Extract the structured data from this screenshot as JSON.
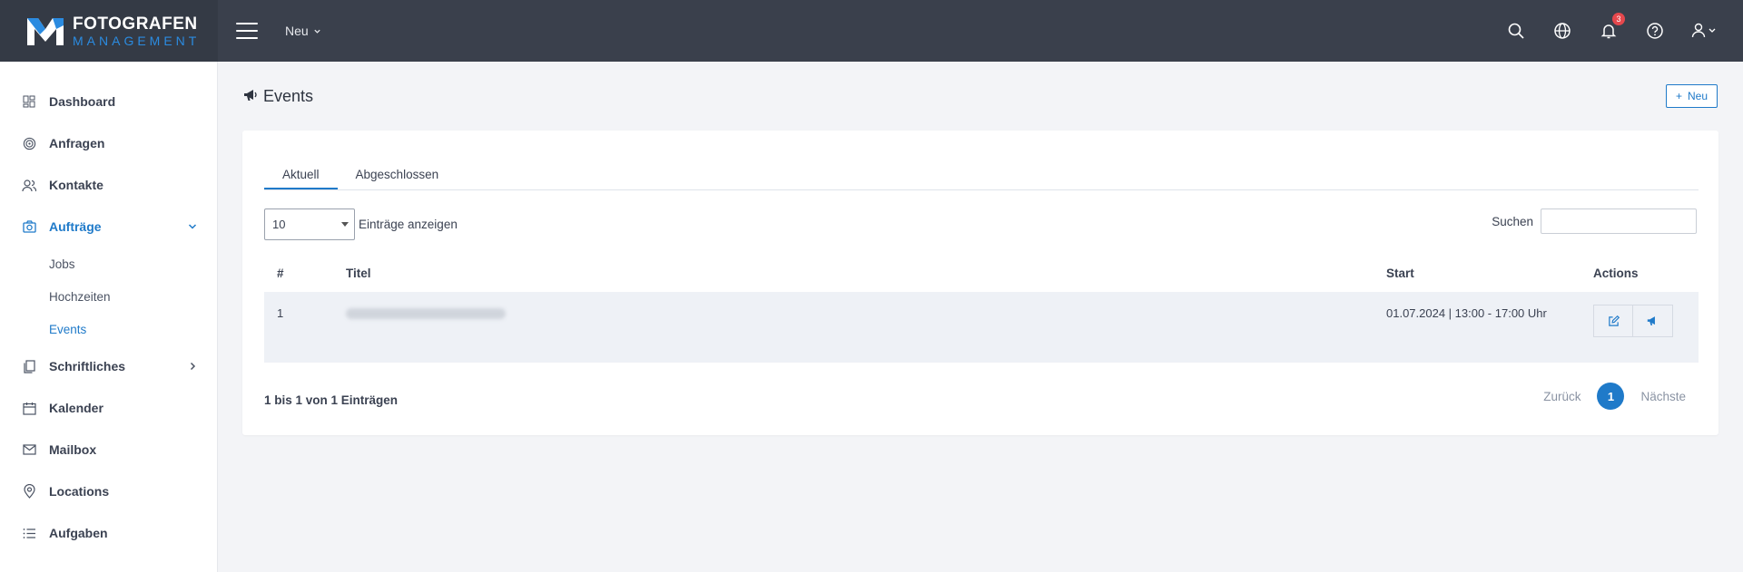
{
  "brand": {
    "line1": "FOTOGRAFEN",
    "line2": "MANAGEMENT",
    "accent": "#1f7ac9"
  },
  "topbar": {
    "new_label": "Neu",
    "notification_count": "3"
  },
  "sidebar": {
    "items": [
      {
        "label": "Dashboard",
        "icon": "dashboard-icon"
      },
      {
        "label": "Anfragen",
        "icon": "target-icon"
      },
      {
        "label": "Kontakte",
        "icon": "users-icon"
      },
      {
        "label": "Aufträge",
        "icon": "camera-icon"
      },
      {
        "label": "Schriftliches",
        "icon": "document-icon"
      },
      {
        "label": "Kalender",
        "icon": "calendar-icon"
      },
      {
        "label": "Mailbox",
        "icon": "mail-icon"
      },
      {
        "label": "Locations",
        "icon": "location-icon"
      },
      {
        "label": "Aufgaben",
        "icon": "list-icon"
      }
    ],
    "subitems": [
      {
        "label": "Jobs"
      },
      {
        "label": "Hochzeiten"
      },
      {
        "label": "Events"
      }
    ]
  },
  "page": {
    "title": "Events",
    "new_button": "Neu"
  },
  "tabs": [
    {
      "label": "Aktuell"
    },
    {
      "label": "Abgeschlossen"
    }
  ],
  "table_controls": {
    "page_length": "10",
    "length_label": "Einträge anzeigen",
    "search_label": "Suchen"
  },
  "table": {
    "columns": [
      "#",
      "Titel",
      "Start",
      "Actions"
    ],
    "rows": [
      {
        "num": "1",
        "start": "01.07.2024 | 13:00 - 17:00 Uhr"
      }
    ]
  },
  "footer": {
    "info": "1 bis 1 von 1 Einträgen",
    "prev": "Zurück",
    "current_page": "1",
    "next": "Nächste"
  }
}
